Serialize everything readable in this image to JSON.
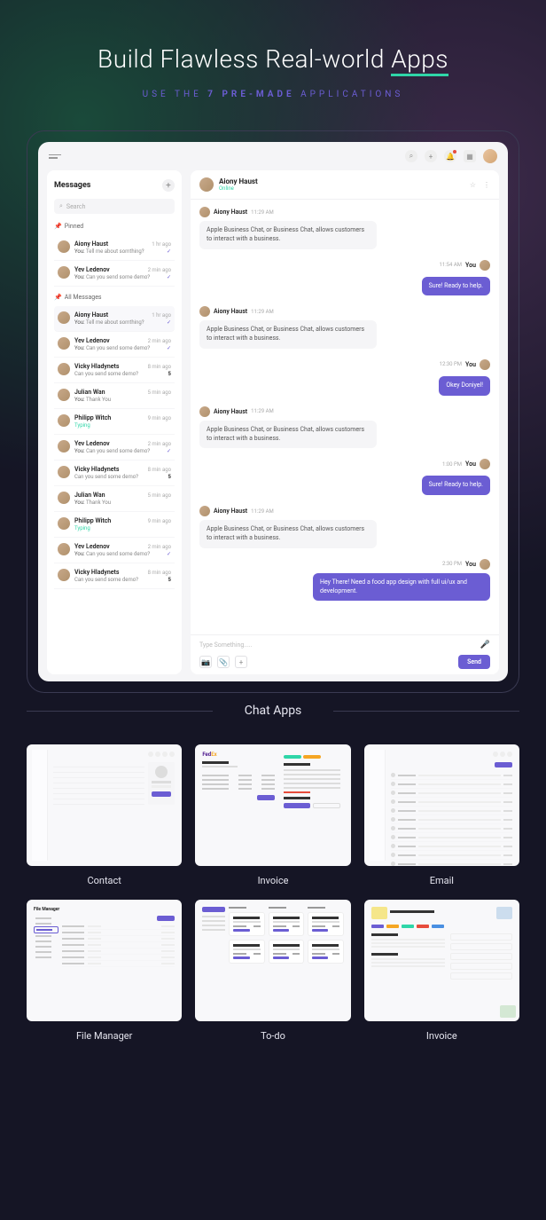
{
  "hero": {
    "title_pre": "Build Flawless Real-world ",
    "title_accent": "Apps",
    "subtitle_pre": "USE THE ",
    "subtitle_bold": "7 PRE-MADE",
    "subtitle_post": " APPLICATIONS"
  },
  "frame_label": "Chat Apps",
  "sidebar": {
    "title": "Messages",
    "search_placeholder": "Search",
    "pinned_label": "Pinned",
    "all_label": "All Messages"
  },
  "pinned": [
    {
      "name": "Aiony Haust",
      "time": "1 hr ago",
      "preview": "You: Tell me about somthing?",
      "check": true
    },
    {
      "name": "Yev Ledenov",
      "time": "2 min ago",
      "preview": "You: Can you send some demo?",
      "check": true
    }
  ],
  "all": [
    {
      "name": "Aiony Haust",
      "time": "1 hr ago",
      "preview": "You: Tell me about somthing?",
      "check": true,
      "active": true
    },
    {
      "name": "Yev Ledenov",
      "time": "2 min ago",
      "preview": "You: Can you send some demo?",
      "check": true
    },
    {
      "name": "Vicky Hladynets",
      "time": "8 min ago",
      "preview": "Can you send some demo?",
      "badge": "5"
    },
    {
      "name": "Julian Wan",
      "time": "5 min ago",
      "preview": "You: Thank You"
    },
    {
      "name": "Philipp Witch",
      "time": "9 min ago",
      "preview": "Typing",
      "typing": true
    },
    {
      "name": "Yev Ledenov",
      "time": "2 min ago",
      "preview": "You: Can you send some demo?",
      "check": true
    },
    {
      "name": "Vicky Hladynets",
      "time": "8 min ago",
      "preview": "Can you send some demo?",
      "badge": "5"
    },
    {
      "name": "Julian Wan",
      "time": "5 min ago",
      "preview": "You: Thank You"
    },
    {
      "name": "Philipp Witch",
      "time": "9 min ago",
      "preview": "Typing",
      "typing": true
    },
    {
      "name": "Yev Ledenov",
      "time": "2 min ago",
      "preview": "You: Can you send some demo?",
      "check": true
    },
    {
      "name": "Vicky Hladynets",
      "time": "8 min ago",
      "preview": "Can you send some demo?",
      "badge": "5"
    }
  ],
  "chat": {
    "header": {
      "name": "Aiony Haust",
      "status": "Online"
    },
    "messages": [
      {
        "side": "left",
        "name": "Aiony Haust",
        "time": "11:29 AM",
        "bubble": "gray",
        "text": "Apple Business Chat, or Business Chat, allows customers to interact with a business."
      },
      {
        "side": "right",
        "name": "You",
        "time": "11:54 AM",
        "bubble": "purple",
        "text": "Sure! Ready to help."
      },
      {
        "side": "left",
        "name": "Aiony Haust",
        "time": "11:29 AM",
        "bubble": "gray",
        "text": "Apple Business Chat, or Business Chat, allows customers to interact with a business."
      },
      {
        "side": "right",
        "name": "You",
        "time": "12:30 PM",
        "bubble": "purple",
        "text": "Okey Doniyel!"
      },
      {
        "side": "left",
        "name": "Aiony Haust",
        "time": "11:29 AM",
        "bubble": "gray",
        "text": "Apple Business Chat, or Business Chat, allows customers to interact with a business."
      },
      {
        "side": "right",
        "name": "You",
        "time": "1:00 PM",
        "bubble": "purple",
        "text": "Sure! Ready to help."
      },
      {
        "side": "left",
        "name": "Aiony Haust",
        "time": "11:29 AM",
        "bubble": "gray",
        "text": "Apple Business Chat, or Business Chat, allows customers to interact with a business."
      },
      {
        "side": "right",
        "name": "You",
        "time": "2:30 PM",
        "bubble": "purple",
        "text": "Hey There! Need a food app design with full ui/ux and development."
      }
    ],
    "composer": {
      "placeholder": "Type Something.....",
      "send": "Send"
    }
  },
  "tiles": [
    {
      "label": "Contact"
    },
    {
      "label": "Invoice"
    },
    {
      "label": "Email"
    },
    {
      "label": "File Manager"
    },
    {
      "label": "To-do"
    },
    {
      "label": "Invoice"
    }
  ]
}
